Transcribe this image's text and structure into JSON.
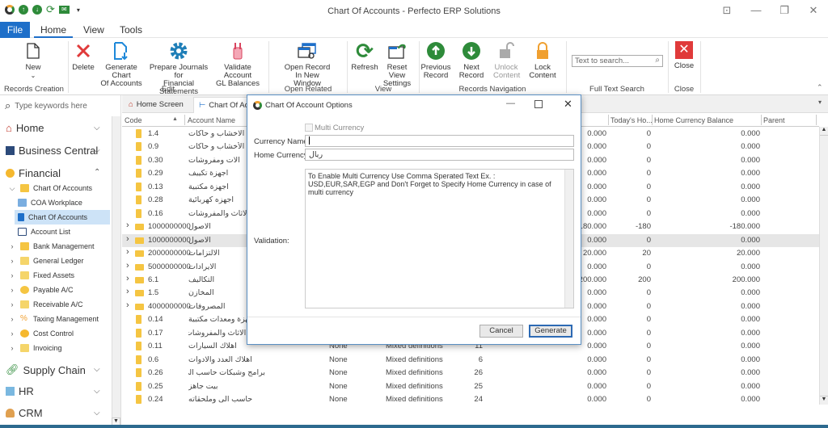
{
  "window": {
    "title": "Chart Of Accounts - Perfecto ERP Solutions",
    "controls": {
      "restore_down_icon": "⊡",
      "minimize": "—",
      "maximize": "❐",
      "close": "✕"
    }
  },
  "quick_access": [
    "app-logo-icon",
    "up-arrow-icon",
    "down-arrow-icon",
    "refresh-icon",
    "mail-icon",
    "dropdown-icon"
  ],
  "menu_tabs": {
    "file": "File",
    "home": "Home",
    "view": "View",
    "tools": "Tools"
  },
  "ribbon": {
    "new": "New",
    "delete": "Delete",
    "generate_line1": "Generate Chart",
    "generate_line2": "Of Accounts",
    "prepare_line1": "Prepare Journals for",
    "prepare_line2": "Financial Statements",
    "validate_line1": "Validate Account",
    "validate_line2": "GL Balances",
    "open_line1": "Open Record",
    "open_line2": "In New Window",
    "refresh": "Refresh",
    "reset_line1": "Reset View",
    "reset_line2": "Settings",
    "previous_line1": "Previous",
    "previous_line2": "Record",
    "next": "Next Record",
    "unlock_line1": "Unlock",
    "unlock_line2": "Content",
    "lock": "Lock Content",
    "search_placeholder": "Text to search...",
    "close": "Close",
    "groups": {
      "records_creation": "Records Creation",
      "edit": "Edit",
      "open_related": "Open Related Record",
      "view": "View",
      "records_navigation": "Records Navigation",
      "full_text_search": "Full Text Search",
      "close": "Close"
    }
  },
  "sidebar": {
    "search_placeholder": "Type keywords here",
    "groups": {
      "home": "Home",
      "business_central": "Business Central",
      "financial": "Financial",
      "supply_chain": "Supply Chain",
      "hr": "HR",
      "crm": "CRM"
    },
    "items": [
      {
        "label": "Chart Of Accounts"
      },
      {
        "label": "COA Workplace"
      },
      {
        "label": "Chart Of Accounts"
      },
      {
        "label": "Account List"
      },
      {
        "label": "Bank Management"
      },
      {
        "label": "General Ledger"
      },
      {
        "label": "Fixed Assets"
      },
      {
        "label": "Payable A/C"
      },
      {
        "label": "Receivable A/C"
      },
      {
        "label": "Taxing Management"
      },
      {
        "label": "Cost Control"
      },
      {
        "label": "Invoicing"
      }
    ]
  },
  "doc_tabs": {
    "home_screen": "Home Screen",
    "chart_of_accounts": "Chart Of Ac"
  },
  "grid": {
    "headers": {
      "code": "Code",
      "account_name": "Account Name",
      "todays_home": "Today's Ho...",
      "home_currency_balance": "Home Currency Balance",
      "parent": "Parent"
    },
    "rows": [
      {
        "code": "1.4",
        "name": "اهلاك الاخشاب و حاكات",
        "type": "leaf",
        "c1": "",
        "c2": "",
        "c3": "",
        "bal": "0.000",
        "today": "0",
        "hcb": "0.000"
      },
      {
        "code": "0.9",
        "name": "اهلاك الأخشاب و حاكات",
        "type": "leaf",
        "c1": "",
        "c2": "",
        "c3": "",
        "bal": "0.000",
        "today": "0",
        "hcb": "0.000"
      },
      {
        "code": "0.30",
        "name": "الات ومفروشات",
        "type": "leaf",
        "c1": "",
        "c2": "",
        "c3": "",
        "bal": "0.000",
        "today": "0",
        "hcb": "0.000"
      },
      {
        "code": "0.29",
        "name": "اجهزة تكييف",
        "type": "leaf",
        "c1": "",
        "c2": "",
        "c3": "",
        "bal": "0.000",
        "today": "0",
        "hcb": "0.000"
      },
      {
        "code": "0.13",
        "name": "اجهزة مكتبية",
        "type": "leaf",
        "c1": "",
        "c2": "",
        "c3": "",
        "bal": "0.000",
        "today": "0",
        "hcb": "0.000"
      },
      {
        "code": "0.28",
        "name": "اجهزه كهربائية",
        "type": "leaf",
        "c1": "",
        "c2": "",
        "c3": "",
        "bal": "0.000",
        "today": "0",
        "hcb": "0.000"
      },
      {
        "code": "0.16",
        "name": "الاثاث والمفروشات",
        "type": "leaf",
        "c1": "",
        "c2": "",
        "c3": "",
        "bal": "0.000",
        "today": "0",
        "hcb": "0.000"
      },
      {
        "code": "1000000000",
        "name": "الاصول",
        "type": "folder",
        "c1": "",
        "c2": "",
        "c3": "",
        "bal": "180.000",
        "today": "-180",
        "hcb": "-180.000"
      },
      {
        "code": "1000000000",
        "name": "الاصول",
        "type": "folder",
        "selected": true,
        "c1": "",
        "c2": "",
        "c3": "",
        "bal": "0.000",
        "today": "0",
        "hcb": "0.000"
      },
      {
        "code": "2000000000",
        "name": "الالتزامات",
        "type": "folder",
        "c1": "",
        "c2": "",
        "c3": "",
        "bal": "20.000",
        "today": "20",
        "hcb": "20.000"
      },
      {
        "code": "5000000000",
        "name": "الايرادات",
        "type": "folder",
        "c1": "",
        "c2": "",
        "c3": "",
        "bal": "0.000",
        "today": "0",
        "hcb": "0.000"
      },
      {
        "code": "6.1",
        "name": "التكاليف",
        "type": "folder",
        "c1": "",
        "c2": "",
        "c3": "",
        "bal": "200.000",
        "today": "200",
        "hcb": "200.000"
      },
      {
        "code": "1.5",
        "name": "المخازن",
        "type": "folder",
        "c1": "",
        "c2": "",
        "c3": "",
        "bal": "0.000",
        "today": "0",
        "hcb": "0.000"
      },
      {
        "code": "4000000000",
        "name": "المصروفات",
        "type": "folder",
        "c1": "",
        "c2": "",
        "c3": "",
        "bal": "0.000",
        "today": "0",
        "hcb": "0.000"
      },
      {
        "code": "0.14",
        "name": "اجهزة ومعدات مكتبية",
        "type": "leaf",
        "c1": "",
        "c2": "",
        "c3": "",
        "bal": "0.000",
        "today": "0",
        "hcb": "0.000"
      },
      {
        "code": "0.17",
        "name": "اهلاك الاثاث والمفروشات",
        "type": "leaf",
        "c1": "",
        "c2": "",
        "c3": "",
        "bal": "0.000",
        "today": "0",
        "hcb": "0.000"
      },
      {
        "code": "0.11",
        "name": "اهلاك السيارات",
        "type": "leaf",
        "c1": "None",
        "c2": "Mixed definitions",
        "c3": "11",
        "bal": "0.000",
        "today": "0",
        "hcb": "0.000"
      },
      {
        "code": "0.6",
        "name": "اهلاك العدد والادوات",
        "type": "leaf",
        "c1": "None",
        "c2": "Mixed definitions",
        "c3": "6",
        "bal": "0.000",
        "today": "0",
        "hcb": "0.000"
      },
      {
        "code": "0.26",
        "name": "برامج وشبكات حاسب الى",
        "type": "leaf",
        "c1": "None",
        "c2": "Mixed definitions",
        "c3": "26",
        "bal": "0.000",
        "today": "0",
        "hcb": "0.000"
      },
      {
        "code": "0.25",
        "name": "بيت جاهز",
        "type": "leaf",
        "c1": "None",
        "c2": "Mixed definitions",
        "c3": "25",
        "bal": "0.000",
        "today": "0",
        "hcb": "0.000"
      },
      {
        "code": "0.24",
        "name": "حاسب الى وملحقاته",
        "type": "leaf",
        "c1": "None",
        "c2": "Mixed definitions",
        "c3": "24",
        "bal": "0.000",
        "today": "0",
        "hcb": "0.000"
      }
    ]
  },
  "dialog": {
    "title": "Chart Of Account Options",
    "multi_currency_label": "Multi Currency",
    "multi_currency_checked": false,
    "currency_name_label": "Currency Name:",
    "currency_name_value": "",
    "home_currency_label": "Home Currency:",
    "home_currency_value": "ريال",
    "validation_label": "Validation:",
    "validation_text": "To Enable Multi Currency Use Comma Sperated Text Ex. : USD,EUR,SAR,EGP and Don't Forget to Specify Home Currency in case of multi currency",
    "cancel": "Cancel",
    "generate": "Generate"
  },
  "colors": {
    "accent": "#1e6fc9",
    "green": "#2e8b3a",
    "red": "#e03a3a",
    "orange": "#f0a030",
    "folder": "#f5c542"
  }
}
